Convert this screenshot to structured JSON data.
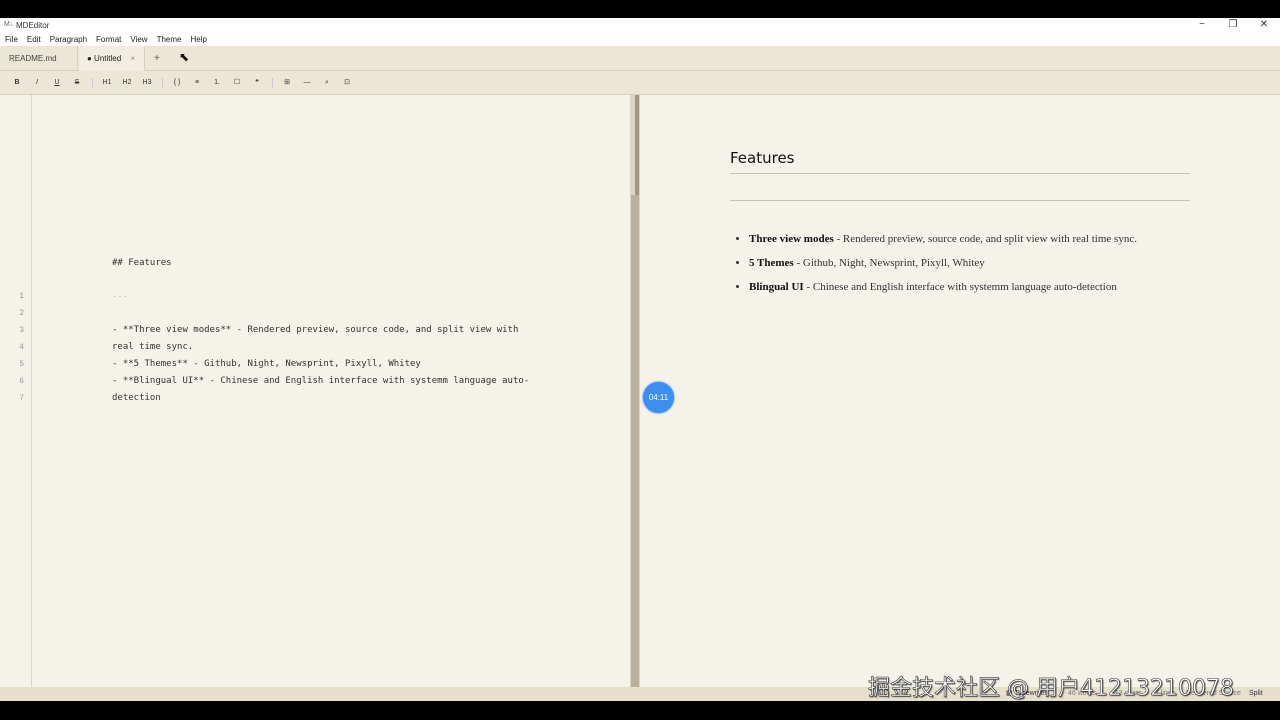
{
  "app": {
    "title": "MDEditor",
    "icon": "markdown-icon",
    "controls": [
      "−",
      "❐",
      "✕"
    ]
  },
  "menu": [
    "File",
    "Edit",
    "Paragraph",
    "Format",
    "View",
    "Theme",
    "Help"
  ],
  "tabs": {
    "items": [
      {
        "label": "README.md"
      },
      {
        "label": "● Untitled",
        "close": "×"
      }
    ],
    "add": "+"
  },
  "toolbar": [
    "B",
    "I",
    "U",
    "S",
    "H1",
    "H2",
    "H3",
    "{ }",
    "≡",
    "1.",
    "☐",
    "❝",
    "⊞",
    "—",
    "⌕",
    "⊡"
  ],
  "editor": {
    "heading_line": "## Features",
    "faded_line": "---",
    "line_numbers": [
      "1",
      "2",
      "3",
      "4",
      "5",
      "6",
      "7"
    ],
    "lines": [
      "- **Three view modes** - Rendered preview, source code, and split view with",
      "real time sync.",
      "- **5 Themes** - Github, Night, Newsprint, Pixyll, Whitey",
      "- **Blingual UI** - Chinese and English interface with systemm language auto-",
      "detection"
    ]
  },
  "preview": {
    "heading": "Features",
    "items": [
      {
        "bold": "Three view modes",
        "text": " - Rendered preview, source code, and split view with real time sync."
      },
      {
        "bold": "5 Themes",
        "text": " - Github, Night, Newsprint, Pixyll, Whitey"
      },
      {
        "bold": "Blingual UI",
        "text": " - Chinese and English interface with systemm language auto-detection"
      }
    ]
  },
  "timer": "04:11",
  "statusbar": {
    "typewriter": "Typewriter",
    "words": "46 words",
    "chars": "213 chars",
    "lines": "7 lines",
    "view_modes": "Rendered Source",
    "split": "Split"
  },
  "watermark": "掘金技术社区 @ 用户41213210078",
  "colors": {
    "paper": "#f5f2ea",
    "chrome": "#ece6d6",
    "timer": "#3b8ff0"
  }
}
